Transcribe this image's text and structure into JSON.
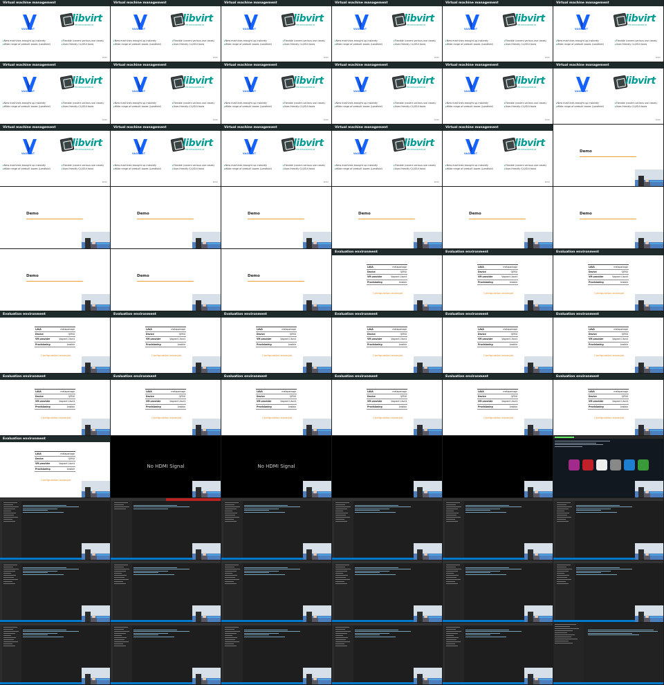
{
  "vm_slide": {
    "title": "Virtual machine management",
    "vagrant_word": "VAGRANT",
    "libvirt_word": "libvirt",
    "libvirt_sub": "THE VIRTUALIZATION API",
    "bullets_left": [
      "New machines brought up instantly",
      "Wide range of prebuilt boxes (Landfold)"
    ],
    "bullets_right": [
      "Flexible (covers various use cases)",
      "User-friendly CLI/GUI tools"
    ],
    "page_number": "00/20"
  },
  "demo_slide": {
    "title": "Demo"
  },
  "eval_slide": {
    "title": "Evaluation environment",
    "rows": [
      [
        "LAVA",
        "metaparkage"
      ],
      [
        "Device",
        "QEMU"
      ],
      [
        "VM provider",
        "Vagrant Libvirt"
      ],
      [
        "Provisioning",
        "Ansible"
      ]
    ],
    "link": "Configuration example"
  },
  "no_signal": {
    "text": "No HDMI Signal"
  },
  "colors": {
    "header": "#1f2b2b",
    "accent": "#009b93",
    "vagrant": "#1563ff",
    "orange": "#e98a1d",
    "vscode_status": "#007acc"
  },
  "frames": [
    "vm",
    "vm",
    "vm",
    "vm",
    "vm",
    "vm",
    "vm",
    "vm",
    "vm",
    "vm",
    "vm",
    "vm_demo",
    "vm",
    "vm",
    "vm",
    "vm",
    "vm",
    "demo",
    "demo",
    "demo",
    "demo",
    "demo",
    "demo",
    "demo",
    "demo",
    "demo",
    "demo",
    "eval",
    "eval",
    "eval",
    "eval",
    "eval",
    "eval",
    "eval",
    "eval",
    "eval",
    "eval",
    "eval",
    "eval",
    "eval",
    "eval",
    "eval",
    "eval",
    "nohdmi",
    "nohdmi",
    "dark",
    "dark",
    "desktop",
    "ide",
    "ide_red",
    "ide",
    "ide",
    "ide",
    "ide",
    "ide",
    "ide",
    "ide",
    "ide",
    "ide",
    "ide",
    "ide",
    "ide",
    "ide",
    "ide",
    "ide",
    "ide_light"
  ]
}
